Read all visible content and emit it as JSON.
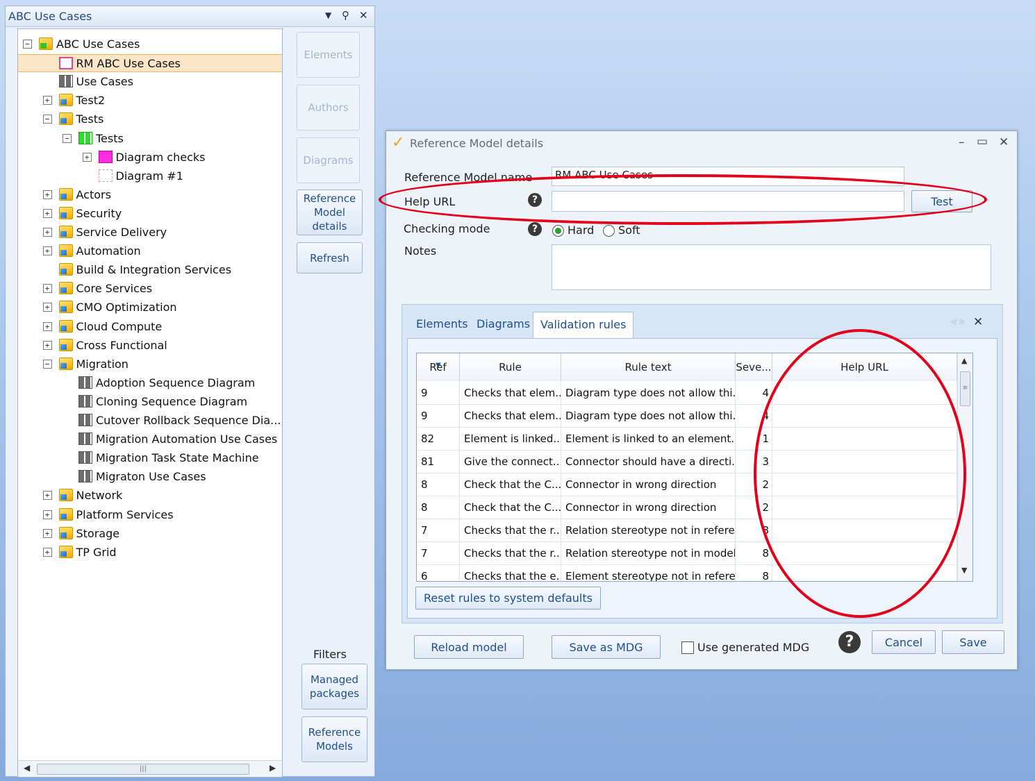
{
  "left_panel": {
    "title": "ABC Use Cases",
    "tree": [
      {
        "label": "ABC Use Cases",
        "indent": 0,
        "expander": "−",
        "icon": "folder-green"
      },
      {
        "label": "RM ABC Use Cases",
        "indent": 1,
        "expander": "",
        "icon": "rm",
        "selected": true
      },
      {
        "label": "Use Cases",
        "indent": 1,
        "expander": "",
        "icon": "diagram"
      },
      {
        "label": "Test2",
        "indent": 1,
        "expander": "+",
        "icon": "folder"
      },
      {
        "label": "Tests",
        "indent": 1,
        "expander": "−",
        "icon": "folder"
      },
      {
        "label": "Tests",
        "indent": 2,
        "expander": "−",
        "icon": "tests"
      },
      {
        "label": "Diagram checks",
        "indent": 3,
        "expander": "+",
        "icon": "package"
      },
      {
        "label": "Diagram  #1",
        "indent": 3,
        "expander": "",
        "icon": "diagram2"
      },
      {
        "label": "Actors",
        "indent": 1,
        "expander": "+",
        "icon": "folder"
      },
      {
        "label": "Security",
        "indent": 1,
        "expander": "+",
        "icon": "folder"
      },
      {
        "label": "Service Delivery",
        "indent": 1,
        "expander": "+",
        "icon": "folder"
      },
      {
        "label": "Automation",
        "indent": 1,
        "expander": "+",
        "icon": "folder"
      },
      {
        "label": "Build & Integration Services",
        "indent": 1,
        "expander": "",
        "icon": "folder"
      },
      {
        "label": "Core Services",
        "indent": 1,
        "expander": "+",
        "icon": "folder"
      },
      {
        "label": "CMO Optimization",
        "indent": 1,
        "expander": "+",
        "icon": "folder"
      },
      {
        "label": "Cloud Compute",
        "indent": 1,
        "expander": "+",
        "icon": "folder"
      },
      {
        "label": "Cross Functional",
        "indent": 1,
        "expander": "+",
        "icon": "folder"
      },
      {
        "label": "Migration",
        "indent": 1,
        "expander": "−",
        "icon": "folder"
      },
      {
        "label": "Adoption Sequence Diagram",
        "indent": 2,
        "expander": "",
        "icon": "diagram"
      },
      {
        "label": "Cloning Sequence Diagram",
        "indent": 2,
        "expander": "",
        "icon": "diagram"
      },
      {
        "label": "Cutover  Rollback  Sequence  Dia...",
        "indent": 2,
        "expander": "",
        "icon": "diagram"
      },
      {
        "label": "Migration Automation Use Cases",
        "indent": 2,
        "expander": "",
        "icon": "diagram"
      },
      {
        "label": "Migration Task State Machine",
        "indent": 2,
        "expander": "",
        "icon": "diagram"
      },
      {
        "label": "Migraton Use Cases",
        "indent": 2,
        "expander": "",
        "icon": "diagram"
      },
      {
        "label": "Network",
        "indent": 1,
        "expander": "+",
        "icon": "folder"
      },
      {
        "label": "Platform Services",
        "indent": 1,
        "expander": "+",
        "icon": "folder"
      },
      {
        "label": "Storage",
        "indent": 1,
        "expander": "+",
        "icon": "folder"
      },
      {
        "label": "TP Grid",
        "indent": 1,
        "expander": "+",
        "icon": "folder"
      }
    ],
    "side_buttons": {
      "elements": "Elements",
      "authors": "Authors",
      "diagrams": "Diagrams",
      "reference_model_details": "Reference Model details",
      "refresh": "Refresh"
    },
    "filters_label": "Filters",
    "bottom_buttons": {
      "managed_packages": "Managed packages",
      "reference_models": "Reference Models"
    }
  },
  "dialog": {
    "title": "Reference Model details",
    "fields": {
      "name_label": "Reference Model name",
      "name_value": "RM ABC Use Cases",
      "help_url_label": "Help URL",
      "help_url_value": "",
      "test_button": "Test",
      "checking_mode_label": "Checking mode",
      "mode_hard": "Hard",
      "mode_soft": "Soft",
      "notes_label": "Notes",
      "notes_value": ""
    },
    "tabs": [
      "Elements",
      "Diagrams",
      "Validation rules"
    ],
    "active_tab": "Validation rules",
    "grid": {
      "columns": [
        "Ref",
        "Rule",
        "Rule text",
        "Seve...",
        "Help URL"
      ],
      "rows": [
        {
          "ref": "9",
          "rule": "Checks that elem...",
          "text": "Diagram type does not allow thi...",
          "sev": "4",
          "url": ""
        },
        {
          "ref": "9",
          "rule": "Checks that elem...",
          "text": "Diagram type does not allow thi...",
          "sev": "4",
          "url": ""
        },
        {
          "ref": "82",
          "rule": "Element is linked...",
          "text": "Element is linked to an element...",
          "sev": "1",
          "url": ""
        },
        {
          "ref": "81",
          "rule": "Give the connect...",
          "text": "Connector should have a directi...",
          "sev": "3",
          "url": ""
        },
        {
          "ref": "8",
          "rule": "Check that the C...",
          "text": "Connector in wrong direction",
          "sev": "2",
          "url": ""
        },
        {
          "ref": "8",
          "rule": "Check that the C...",
          "text": "Connector in wrong direction",
          "sev": "2",
          "url": ""
        },
        {
          "ref": "7",
          "rule": "Checks that the r...",
          "text": "Relation stereotype not in refere...",
          "sev": "8",
          "url": ""
        },
        {
          "ref": "7",
          "rule": "Checks that the r...",
          "text": "Relation stereotype not in model",
          "sev": "8",
          "url": ""
        },
        {
          "ref": "6",
          "rule": "Checks that the e...",
          "text": "Element stereotype not in refere...",
          "sev": "8",
          "url": ""
        }
      ]
    },
    "reset_button": "Reset rules to system defaults",
    "footer": {
      "reload_model": "Reload model",
      "save_as_mdg": "Save as MDG",
      "use_generated_mdg": "Use generated MDG",
      "cancel": "Cancel",
      "save": "Save"
    }
  },
  "colors": {
    "highlight_ellipse": "#e3001b",
    "accent_text": "#1f4f8c",
    "selected_row": "#fde6c8"
  }
}
